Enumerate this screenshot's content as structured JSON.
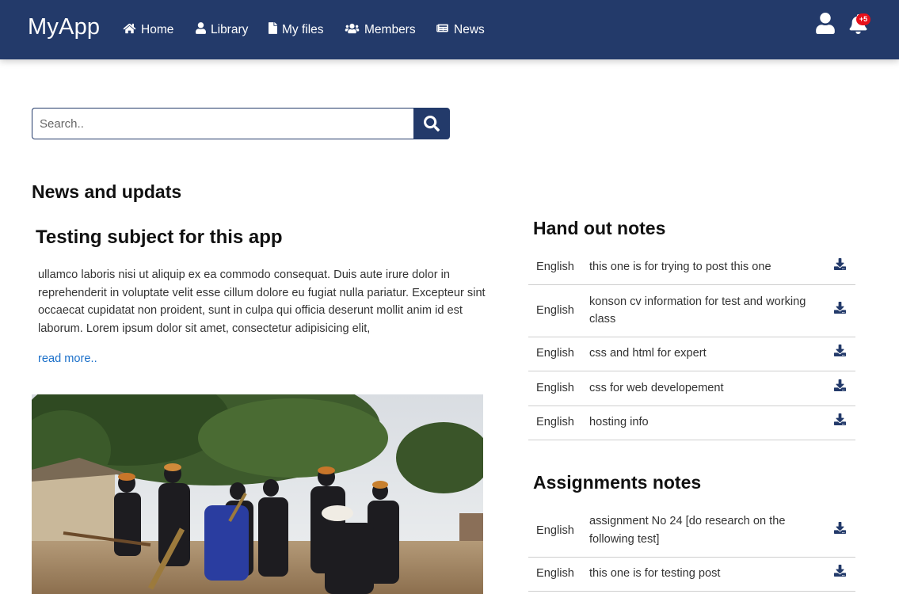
{
  "navbar": {
    "brand": "MyApp",
    "items": [
      {
        "label": "Home",
        "icon": "home-icon"
      },
      {
        "label": "Library",
        "icon": "user-icon"
      },
      {
        "label": "My files",
        "icon": "file-icon"
      },
      {
        "label": "Members",
        "icon": "users-icon"
      },
      {
        "label": "News",
        "icon": "newspaper-icon"
      }
    ],
    "notification_count": "+5",
    "accent_color": "#233a6a"
  },
  "search": {
    "placeholder": "Search.."
  },
  "news": {
    "section_title": "News and updats",
    "article": {
      "title": "Testing subject for this app",
      "body": "ullamco laboris nisi ut aliquip ex ea commodo consequat. Duis aute irure dolor in reprehenderit in voluptate velit esse cillum dolore eu fugiat nulla pariatur. Excepteur sint occaecat cupidatat non proident, sunt in culpa qui officia deserunt mollit anim id est laborum. Lorem ipsum dolor sit amet, consectetur adipisicing elit,",
      "read_more": "read more.."
    }
  },
  "handout_notes": {
    "title": "Hand out notes",
    "rows": [
      {
        "language": "English",
        "description": "this one is for trying to post this one"
      },
      {
        "language": "English",
        "description": "konson cv information for test and working class"
      },
      {
        "language": "English",
        "description": "css and html for expert"
      },
      {
        "language": "English",
        "description": "css for web developement"
      },
      {
        "language": "English",
        "description": "hosting info"
      }
    ]
  },
  "assignment_notes": {
    "title": "Assignments notes",
    "rows": [
      {
        "language": "English",
        "description": "assignment No 24 [do research on the following test]"
      },
      {
        "language": "English",
        "description": "this one is for testing post"
      }
    ]
  }
}
